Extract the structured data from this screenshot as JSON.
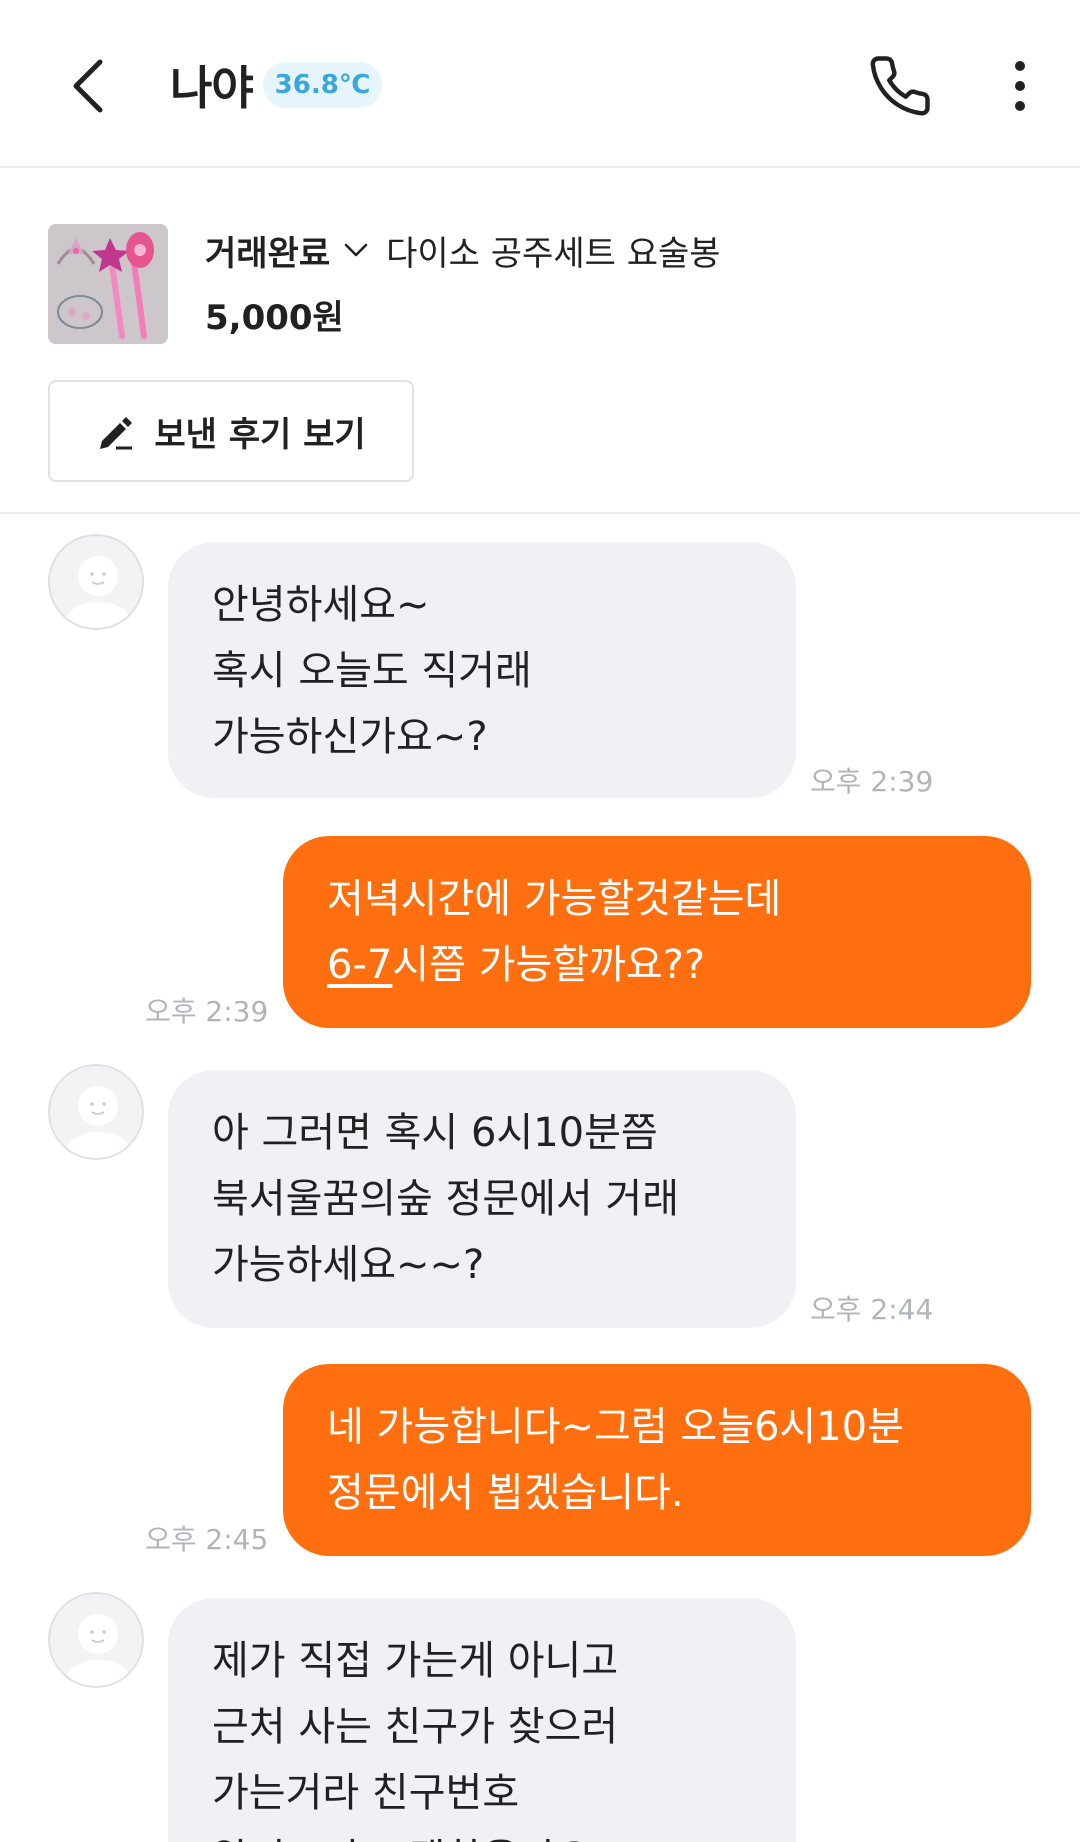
{
  "header": {
    "title": "나야",
    "temperature": "36.8℃",
    "back_icon": "chevron-left-icon",
    "call_icon": "phone-icon",
    "more_icon": "more-vertical-icon"
  },
  "product": {
    "status": "거래완료",
    "name": "다이소 공주세트 요술봉",
    "price": "5,000원",
    "review_button": "보낸 후기 보기"
  },
  "messages": [
    {
      "side": "in",
      "text": "안녕하세요~\n혹시 오늘도 직거래\n가능하신가요~?",
      "time": "오후 2:39"
    },
    {
      "side": "out",
      "text_prefix": "저녁시간에 가능할것같는데\n",
      "text_underlined": "6-7",
      "text_suffix": "시쯤 가능할까요??",
      "time": "오후 2:39"
    },
    {
      "side": "in",
      "text": "아 그러면 혹시 6시10분쯤\n북서울꿈의숲 정문에서 거래\n가능하세요~~?",
      "time": "오후 2:44"
    },
    {
      "side": "out",
      "text": "네 가능합니다~그럼 오늘6시10분\n정문에서 뵙겠습니다.",
      "time": "오후 2:45"
    },
    {
      "side": "in",
      "text": "제가 직접 가는게 아니고\n근처 사는 친구가 찾으러\n가는거라 친구번호\n알려드리고 괜찮을까요?",
      "time": ""
    }
  ],
  "colors": {
    "accent": "#ff6f0f",
    "incoming_bubble": "#f0f1f4",
    "temperature": "#3aa7dc"
  }
}
